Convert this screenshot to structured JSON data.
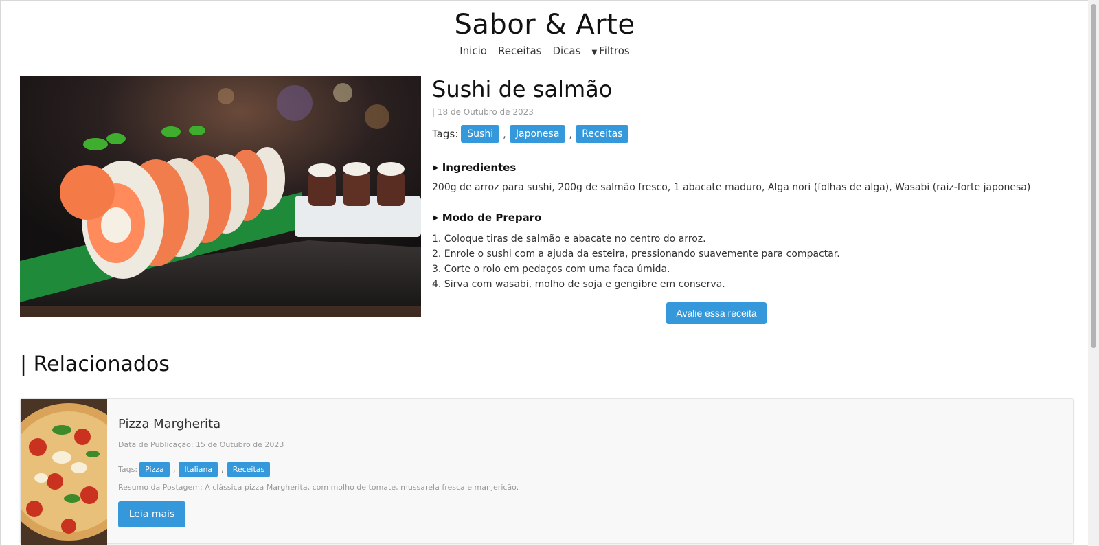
{
  "site": {
    "title": "Sabor & Arte"
  },
  "nav": {
    "items": [
      "Inicio",
      "Receitas",
      "Dicas"
    ],
    "filters": "Filtros"
  },
  "recipe": {
    "title": "Sushi de salmão",
    "date": "| 18 de Outubro de 2023",
    "tags_label": "Tags:",
    "tags": [
      "Sushi",
      "Japonesa",
      "Receitas"
    ],
    "tag_separator": ",",
    "ingredients_label": "Ingredientes",
    "ingredients": "200g de arroz para sushi, 200g de salmão fresco, 1 abacate maduro, Alga nori (folhas de alga), Wasabi (raiz-forte japonesa)",
    "preparation_label": "Modo de Preparo",
    "steps": [
      "1. Coloque tiras de salmão e abacate no centro do arroz.",
      "2. Enrole o sushi com a ajuda da esteira, pressionando suavemente para compactar.",
      "3. Corte o rolo em pedaços com uma faca úmida.",
      "4. Sirva com wasabi, molho de soja e gengibre em conserva."
    ],
    "rate_button": "Avalie essa receita"
  },
  "related": {
    "heading": "| Relacionados",
    "items": [
      {
        "title": "Pizza Margherita",
        "date": "Data de Publicação: 15 de Outubro de 2023",
        "tags_label": "Tags:",
        "tags": [
          "Pizza",
          "Italiana",
          "Receitas"
        ],
        "summary": "Resumo da Postagem: A clássica pizza Margherita, com molho de tomate, mussarela fresca e manjericão.",
        "read_more": "Leia mais"
      }
    ]
  },
  "colors": {
    "accent": "#3498db",
    "card_bg": "#f8f8f8",
    "muted_text": "#999999"
  }
}
